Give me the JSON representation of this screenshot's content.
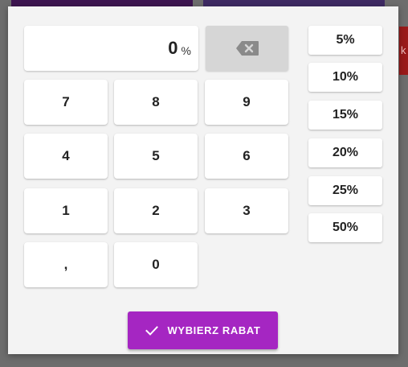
{
  "background": {
    "side_text": "k"
  },
  "display": {
    "value": "0",
    "unit": "%"
  },
  "backspace": {
    "icon": "backspace-icon"
  },
  "keypad": {
    "k7": "7",
    "k8": "8",
    "k9": "9",
    "k4": "4",
    "k5": "5",
    "k6": "6",
    "k1": "1",
    "k2": "2",
    "k3": "3",
    "comma": ",",
    "k0": "0"
  },
  "presets": [
    "5%",
    "10%",
    "15%",
    "20%",
    "25%",
    "50%"
  ],
  "confirm": {
    "label": "WYBIERZ RABAT",
    "icon": "check-icon"
  },
  "colors": {
    "accent": "#a526c2",
    "backspace_bg": "#d6d6d6",
    "dialog_bg": "#f3f3f3"
  }
}
